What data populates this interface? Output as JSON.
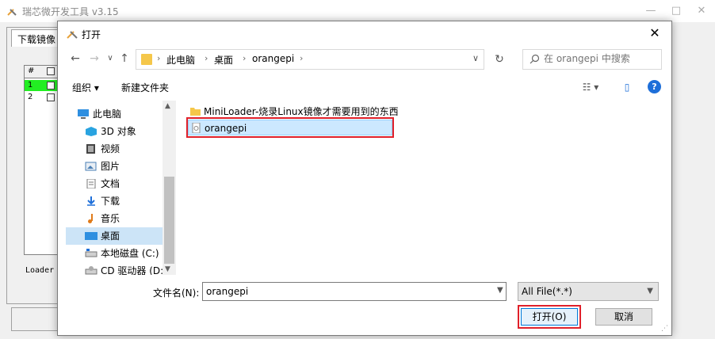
{
  "app": {
    "title": "瑞芯微开发工具 v3.15",
    "tab_label": "下载镜像",
    "grid_header": "#",
    "rows": [
      "1",
      "2"
    ],
    "loader_label": "Loader",
    "win_controls": [
      "—",
      "□",
      "✕"
    ]
  },
  "dialog": {
    "title": "打开",
    "close": "✕",
    "nav": {
      "back": "←",
      "forward": "→",
      "recent": "∨",
      "up": "↑"
    },
    "breadcrumb": [
      "此电脑",
      "桌面",
      "orangepi"
    ],
    "breadcrumb_sep": "›",
    "address_dropdown": "∨",
    "refresh": "↻",
    "search_placeholder": "在 orangepi 中搜索",
    "toolbar": {
      "organize": "组织 ▾",
      "new_folder": "新建文件夹",
      "view": "☷ ▾",
      "pane": "▯",
      "help": "?"
    },
    "nav_items": [
      {
        "label": "此电脑",
        "icon": "computer-icon"
      },
      {
        "label": "3D 对象",
        "icon": "3d-objects-icon"
      },
      {
        "label": "视频",
        "icon": "video-icon"
      },
      {
        "label": "图片",
        "icon": "pictures-icon"
      },
      {
        "label": "文档",
        "icon": "documents-icon"
      },
      {
        "label": "下载",
        "icon": "download-icon"
      },
      {
        "label": "音乐",
        "icon": "music-icon"
      },
      {
        "label": "桌面",
        "icon": "desktop-icon"
      },
      {
        "label": "本地磁盘 (C:)",
        "icon": "disk-icon"
      },
      {
        "label": "CD 驱动器 (D:)",
        "icon": "cd-drive-icon"
      }
    ],
    "files": [
      {
        "name": "MiniLoader-烧录Linux镜像才需要用到的东西",
        "type": "folder"
      },
      {
        "name": "orangepi",
        "type": "file"
      }
    ],
    "filename_label": "文件名(N):",
    "filename_value": "orangepi",
    "filter_value": "All File(*.*)",
    "open_button": "打开(O)",
    "cancel_button": "取消"
  },
  "colors": {
    "highlight_border": "#e0202a",
    "selection": "#cce8ff",
    "accent": "#0078d7",
    "folder": "#f5c74a",
    "row_selected": "#22ee22"
  }
}
